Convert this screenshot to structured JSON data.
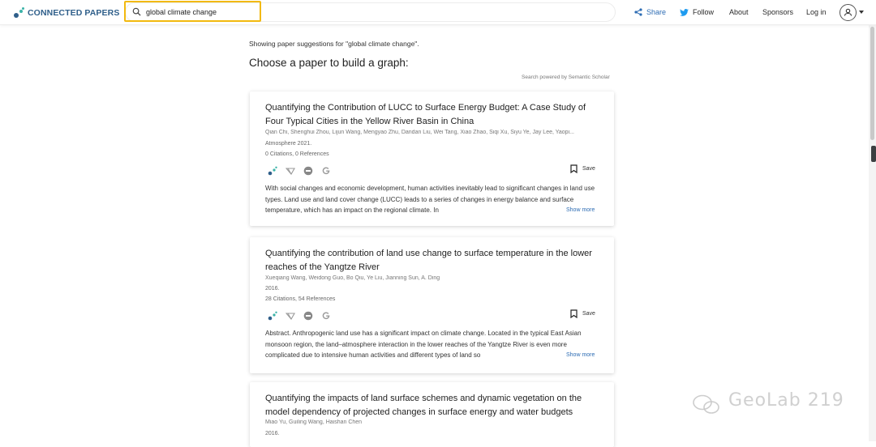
{
  "header": {
    "logo_text": "CONNECTED PAPERS",
    "search_value": "global climate change",
    "nav": {
      "share": "Share",
      "follow": "Follow",
      "about": "About",
      "sponsors": "Sponsors",
      "login": "Log in"
    }
  },
  "main": {
    "intro": "Showing paper suggestions for \"global climate change\".",
    "heading": "Choose a paper to build a graph:",
    "powered_by": "Search powered by Semantic Scholar",
    "save_label": "Save",
    "show_more_label": "Show more",
    "papers": [
      {
        "title": "Quantifying the Contribution of LUCC to Surface Energy Budget: A Case Study of Four Typical Cities in the Yellow River Basin in China",
        "authors": "Qian Chi, Shenghui Zhou, Lijun Wang, Mengyao Zhu, Dandan Liu, Wei Tang, Xiao Zhao, Siqi Xu, Siyu Ye, Jay Lee, Yaopi...",
        "venue": "Atmosphere 2021.",
        "citations": "0 Citations, 0 References",
        "abstract": "With social changes and economic development, human activities inevitably lead to significant changes in land use types. Land use and land cover change (LUCC) leads to a series of changes in energy balance and surface temperature, which has an impact on the regional climate. In"
      },
      {
        "title": "Quantifying the contribution of land use change to surface temperature in the lower reaches of the Yangtze River",
        "authors": "Xueqiang Wang, Weidong Guo, Bo Qiu, Ye Liu, Jianning Sun, A. Ding",
        "venue": "2016.",
        "citations": "28 Citations, 54 References",
        "abstract": "Abstract. Anthropogenic land use has a significant impact on climate change. Located in the typical East Asian monsoon region, the land–atmosphere interaction in the lower reaches of the Yangtze River is even more complicated due to intensive human activities and different types of land so"
      },
      {
        "title": "Quantifying the impacts of land surface schemes and dynamic vegetation on the model dependency of projected changes in surface energy and water budgets",
        "authors": "Miao Yu, Guiling Wang, Haishan Chen",
        "venue": "2016."
      }
    ]
  },
  "watermark": "GeoLab 219",
  "colors": {
    "accent_blue": "#2e6db4",
    "highlight_border": "#f2b90f",
    "logo_teal": "#3bb3a8"
  }
}
